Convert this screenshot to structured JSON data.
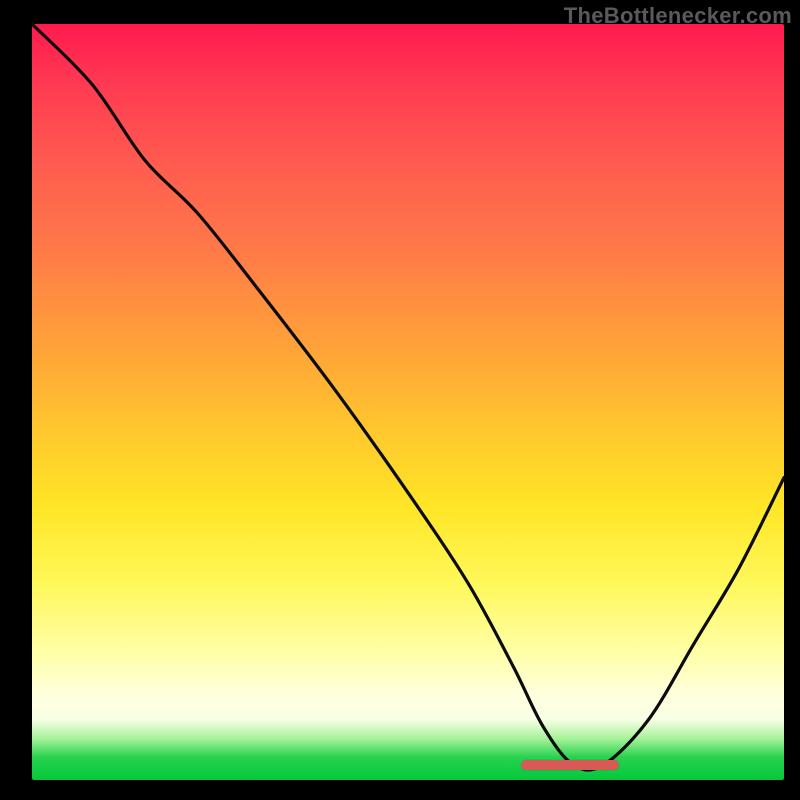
{
  "source_label": "TheBottlenecker.com",
  "marker": {
    "x_frac_start": 0.655,
    "x_frac_end": 0.78,
    "thickness_px": 10,
    "color": "#d85a56"
  },
  "chart_data": {
    "type": "line",
    "title": "",
    "xlabel": "",
    "ylabel": "",
    "xlim": [
      0,
      100
    ],
    "ylim": [
      0,
      100
    ],
    "series": [
      {
        "name": "bottleneck-curve",
        "x": [
          0,
          8,
          15,
          22,
          30,
          40,
          50,
          58,
          64,
          68,
          72,
          76,
          82,
          88,
          94,
          100
        ],
        "values": [
          100,
          92,
          82,
          75,
          65,
          52,
          38,
          26,
          15,
          7,
          2,
          2,
          8,
          18,
          28,
          40
        ]
      }
    ],
    "annotations": [
      {
        "name": "optimal-range-marker",
        "x_start": 65,
        "x_end": 78,
        "y": 2
      }
    ],
    "background": "red-to-green vertical heat gradient"
  }
}
